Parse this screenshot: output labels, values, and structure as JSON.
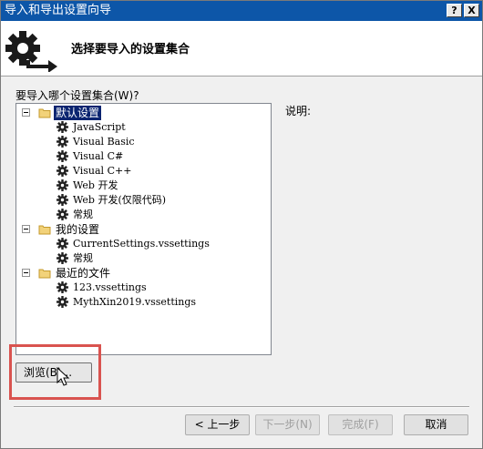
{
  "window": {
    "title": "导入和导出设置向导",
    "help_glyph": "?",
    "close_glyph": "X"
  },
  "header": {
    "icon": "gear-arrow-icon",
    "text": "选择要导入的设置集合"
  },
  "prompt": "要导入哪个设置集合(W)?",
  "description_label": "说明:",
  "tree": {
    "categories": [
      {
        "label": "默认设置",
        "selected": true,
        "items": [
          "JavaScript",
          "Visual Basic",
          "Visual C#",
          "Visual C++",
          "Web 开发",
          "Web 开发(仅限代码)",
          "常规"
        ]
      },
      {
        "label": "我的设置",
        "selected": false,
        "items": [
          "CurrentSettings.vssettings",
          "常规"
        ]
      },
      {
        "label": "最近的文件",
        "selected": false,
        "items": [
          "123.vssettings",
          "MythXin2019.vssettings"
        ]
      }
    ]
  },
  "browse_button": "浏览(B)...",
  "buttons": {
    "back": "< 上一步",
    "next": "下一步(N)",
    "finish": "完成(F)",
    "cancel": "取消"
  },
  "colors": {
    "titlebar": "#0d56a8",
    "selection": "#0a2470",
    "highlight_box": "#d9534f"
  }
}
